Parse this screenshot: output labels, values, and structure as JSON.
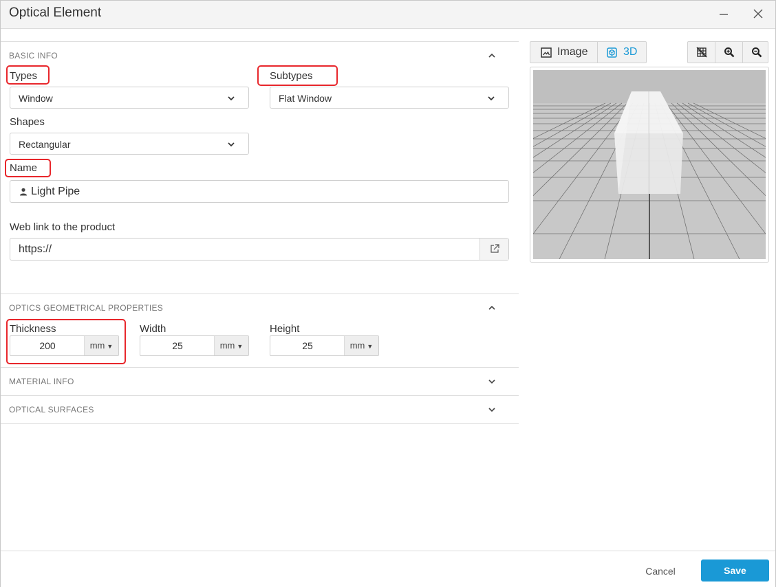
{
  "window": {
    "title": "Optical Element"
  },
  "basic_info": {
    "section_label": "BASIC INFO",
    "types_label": "Types",
    "types_value": "Window",
    "subtypes_label": "Subtypes",
    "subtypes_value": "Flat Window",
    "shapes_label": "Shapes",
    "shapes_value": "Rectangular",
    "name_label": "Name",
    "name_value": "Light Pipe",
    "weblink_label": "Web link to the product",
    "weblink_value": "https://"
  },
  "geometry": {
    "section_label": "OPTICS GEOMETRICAL PROPERTIES",
    "thickness_label": "Thickness",
    "thickness_value": "200",
    "thickness_unit": "mm",
    "width_label": "Width",
    "width_value": "25",
    "width_unit": "mm",
    "height_label": "Height",
    "height_value": "25",
    "height_unit": "mm"
  },
  "material_info": {
    "section_label": "MATERIAL INFO"
  },
  "optical_surfaces": {
    "section_label": "OPTICAL SURFACES"
  },
  "preview": {
    "image_tab": "Image",
    "threed_tab": "3D",
    "active_tab": "3D"
  },
  "footer": {
    "cancel_label": "Cancel",
    "save_label": "Save"
  },
  "colors": {
    "accent": "#1a99d6",
    "highlight": "#e8262b",
    "save_bg": "#1a99d6"
  }
}
